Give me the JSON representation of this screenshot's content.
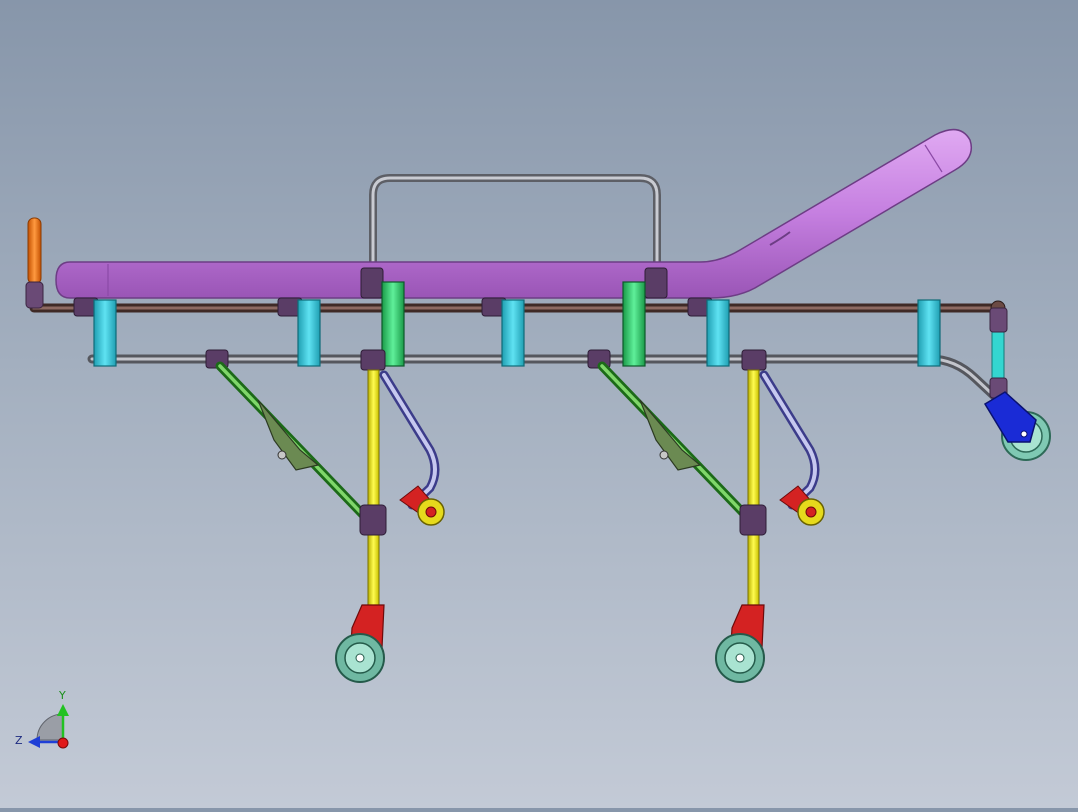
{
  "viewport": {
    "background_top": "#8796aa",
    "background_bottom": "#c3cad6"
  },
  "triad": {
    "y_label": "Y",
    "z_label": "Z",
    "y_color": "#22c222",
    "z_color": "#1f3fd6",
    "x_color": "#e01818"
  },
  "colors": {
    "mattress": "#c77fe3",
    "frame_tube": "#6b4a44",
    "lower_tube": "#8f9099",
    "clip": "#2fc4d8",
    "clip_green": "#2fcf6a",
    "joint": "#5a3d66",
    "leg": "#f2ee1c",
    "strut": "#4dbb3a",
    "wheel_bracket": "#d42222",
    "wheel": "#6fb8a2",
    "handle": "#f0761a",
    "caster_blue": "#1a2bd6",
    "cyan_post": "#34d6d0"
  }
}
